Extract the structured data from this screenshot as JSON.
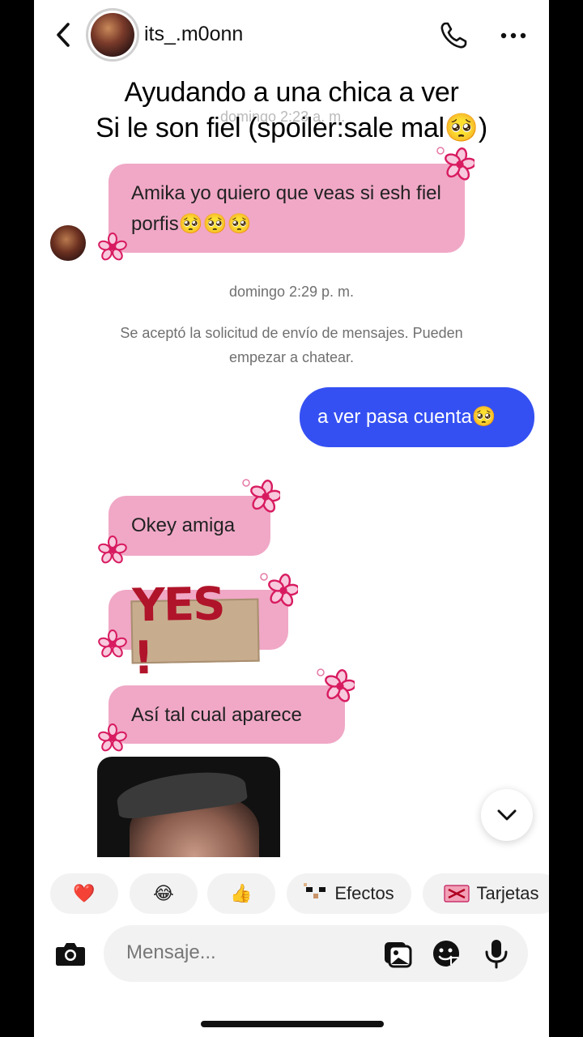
{
  "header": {
    "username": "its_.m0onn"
  },
  "caption": {
    "line1": "Ayudando a una chica a ver",
    "line2": "Si le son fiel (spoiler:sale mal🥺)"
  },
  "ghost_timestamp": "domingo 2:23 a. m.",
  "messages": {
    "m1": "Amika yo quiero que veas si esh fiel porfis🥺🥺🥺",
    "out1": "a ver pasa cuenta🥺",
    "m2": "Okey amiga",
    "sticker": "YES !",
    "m4": "Así tal cual aparece"
  },
  "timestamp2": "domingo 2:29 p. m.",
  "system_note": "Se aceptó la solicitud de envío de mensajes. Pueden empezar a chatear.",
  "quick_reactions": [
    {
      "emoji": "❤️"
    },
    {
      "emoji": "😂"
    },
    {
      "emoji": "👍"
    },
    {
      "label": "Efectos"
    },
    {
      "label": "Tarjetas"
    }
  ],
  "composer": {
    "placeholder": "Mensaje..."
  },
  "colors": {
    "incoming_bubble": "#f0a8c6",
    "outgoing_bubble": "#3550f2",
    "flower": "#d81b60"
  }
}
